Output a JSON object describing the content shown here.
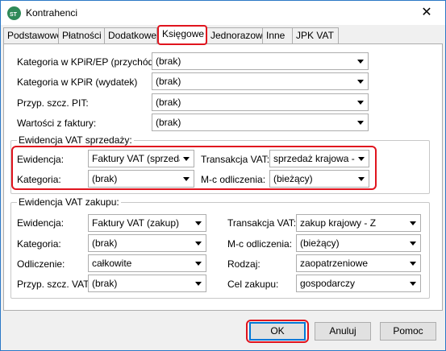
{
  "window": {
    "title": "Kontrahenci",
    "close_glyph": "✕"
  },
  "tabs": [
    {
      "label": "Podstawowe"
    },
    {
      "label": "Płatności"
    },
    {
      "label": "Dodatkowe"
    },
    {
      "label": "Księgowe",
      "active": true
    },
    {
      "label": "Jednorazowi"
    },
    {
      "label": "Inne"
    },
    {
      "label": "JPK VAT"
    }
  ],
  "top_fields": [
    {
      "label": "Kategoria w KPiR/EP (przychód):",
      "value": "(brak)"
    },
    {
      "label": "Kategoria w KPiR (wydatek)",
      "value": "(brak)"
    },
    {
      "label": "Przyp. szcz. PIT:",
      "value": "(brak)"
    },
    {
      "label": "Wartości z faktury:",
      "value": "(brak)"
    }
  ],
  "sales": {
    "title": "Ewidencja VAT sprzedaży:",
    "ewidencja": {
      "label": "Ewidencja:",
      "value": "Faktury VAT (sprzedaż"
    },
    "transakcja": {
      "label": "Transakcja VAT:",
      "value": "sprzedaż krajowa - S"
    },
    "kategoria": {
      "label": "Kategoria:",
      "value": "(brak)"
    },
    "mc": {
      "label": "M-c odliczenia:",
      "value": "(bieżący)"
    }
  },
  "purchase": {
    "title": "Ewidencja VAT zakupu:",
    "ewidencja": {
      "label": "Ewidencja:",
      "value": "Faktury VAT (zakup)"
    },
    "transakcja": {
      "label": "Transakcja VAT:",
      "value": "zakup krajowy - Z"
    },
    "kategoria": {
      "label": "Kategoria:",
      "value": "(brak)"
    },
    "mc": {
      "label": "M-c odliczenia:",
      "value": "(bieżący)"
    },
    "odliczenie": {
      "label": "Odliczenie:",
      "value": "całkowite"
    },
    "rodzaj": {
      "label": "Rodzaj:",
      "value": "zaopatrzeniowe"
    },
    "pit": {
      "label": "Przyp. szcz. VAT:",
      "value": "(brak)"
    },
    "cel": {
      "label": "Cel zakupu:",
      "value": "gospodarczy"
    }
  },
  "buttons": {
    "ok": "OK",
    "cancel": "Anuluj",
    "help": "Pomoc"
  },
  "colors": {
    "highlight": "#e0141e",
    "accent": "#0078d7",
    "app_icon": "#2f8a58"
  }
}
